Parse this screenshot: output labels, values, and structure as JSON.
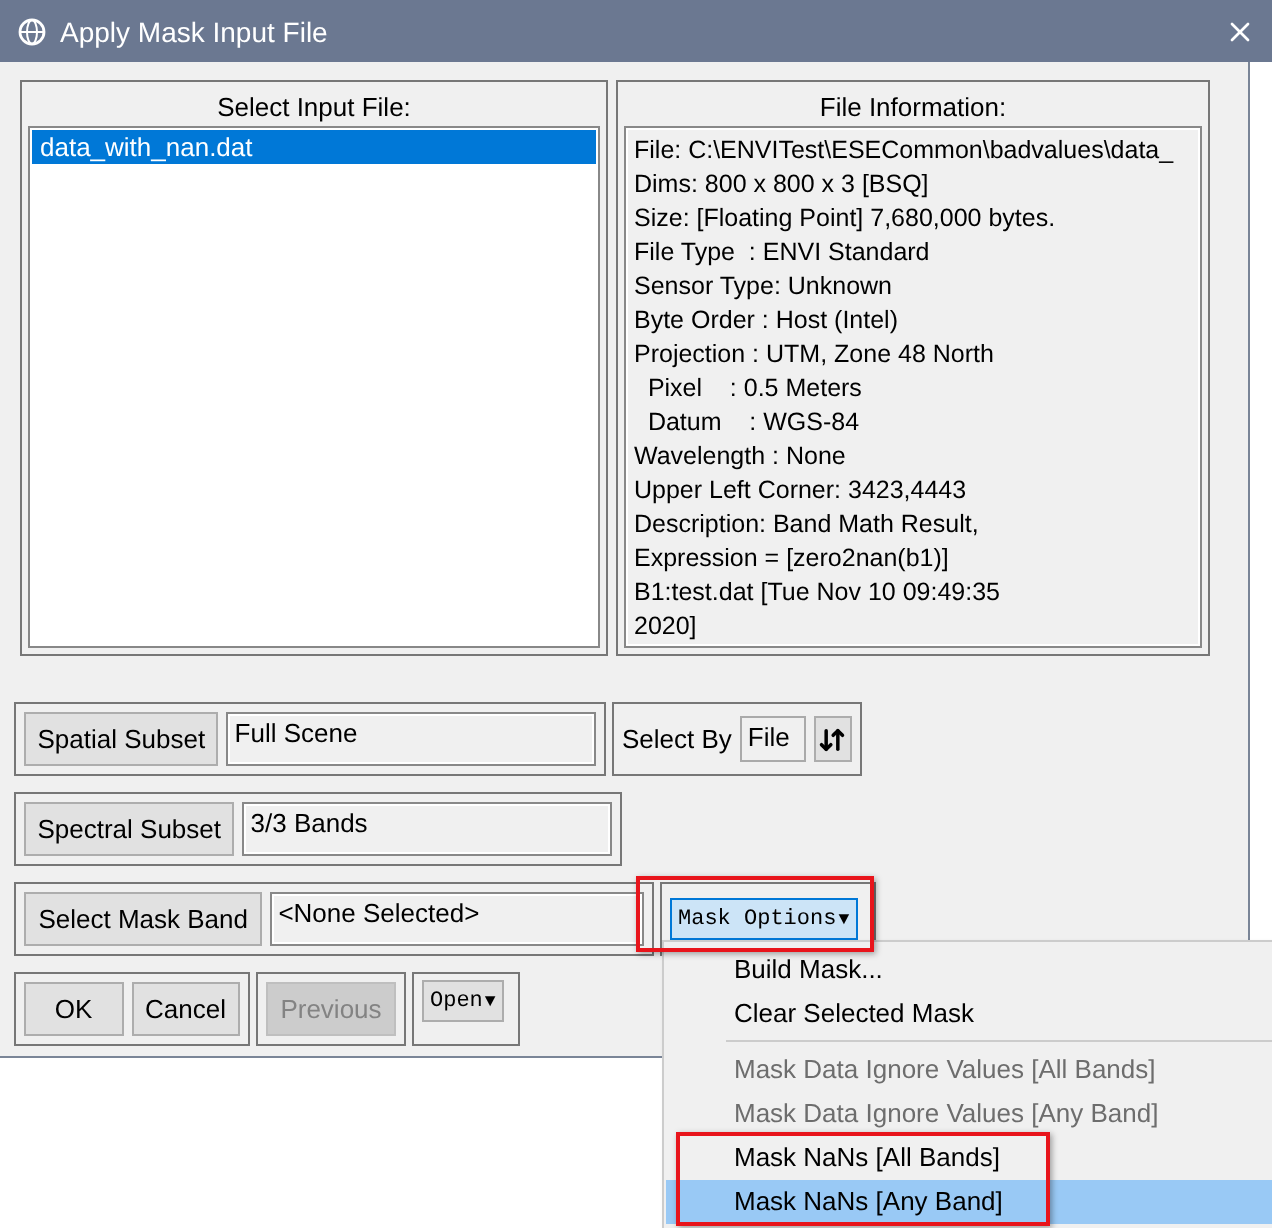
{
  "window": {
    "title": "Apply Mask Input File"
  },
  "input_list": {
    "title": "Select Input File:",
    "items": [
      {
        "label": "data_with_nan.dat",
        "selected": true
      }
    ]
  },
  "file_info": {
    "title": "File Information:",
    "lines": [
      "File: C:\\ENVITest\\ESECommon\\badvalues\\data_",
      "Dims: 800 x 800 x 3 [BSQ]",
      "Size: [Floating Point] 7,680,000 bytes.",
      "File Type  : ENVI Standard",
      "Sensor Type: Unknown",
      "Byte Order : Host (Intel)",
      "Projection : UTM, Zone 48 North",
      "  Pixel    : 0.5 Meters",
      "  Datum    : WGS-84",
      "Wavelength : None",
      "Upper Left Corner: 3423,4443",
      "Description: Band Math Result,",
      "Expression = [zero2nan(b1)]",
      "B1:test.dat [Tue Nov 10 09:49:35",
      "2020]"
    ]
  },
  "spatial_subset": {
    "button": "Spatial Subset",
    "value": "Full Scene"
  },
  "select_by": {
    "label": "Select By",
    "value": "File"
  },
  "spectral_subset": {
    "button": "Spectral Subset",
    "value": "3/3 Bands"
  },
  "mask_band": {
    "button": "Select Mask Band",
    "value": "<None Selected>"
  },
  "mask_options": {
    "label": "Mask Options",
    "arrow": "▼",
    "open": true
  },
  "buttons": [
    {
      "label": "OK",
      "disabled": false
    },
    {
      "label": "Cancel",
      "disabled": false
    },
    {
      "label": "Previous",
      "disabled": true
    }
  ],
  "open_menu": {
    "label": "Open",
    "arrow": "▼"
  },
  "mask_menu": [
    {
      "kind": "item",
      "label": "Build Mask...",
      "disabled": false,
      "selected": false
    },
    {
      "kind": "item",
      "label": "Clear Selected Mask",
      "disabled": false,
      "selected": false
    },
    {
      "kind": "separator"
    },
    {
      "kind": "item",
      "label": "Mask Data Ignore Values [All Bands]",
      "disabled": true,
      "selected": false
    },
    {
      "kind": "item",
      "label": "Mask Data Ignore Values [Any Band]",
      "disabled": true,
      "selected": false
    },
    {
      "kind": "item",
      "label": "Mask NaNs [All Bands]",
      "disabled": false,
      "selected": false
    },
    {
      "kind": "item",
      "label": "Mask NaNs [Any Band]",
      "disabled": false,
      "selected": true
    }
  ]
}
